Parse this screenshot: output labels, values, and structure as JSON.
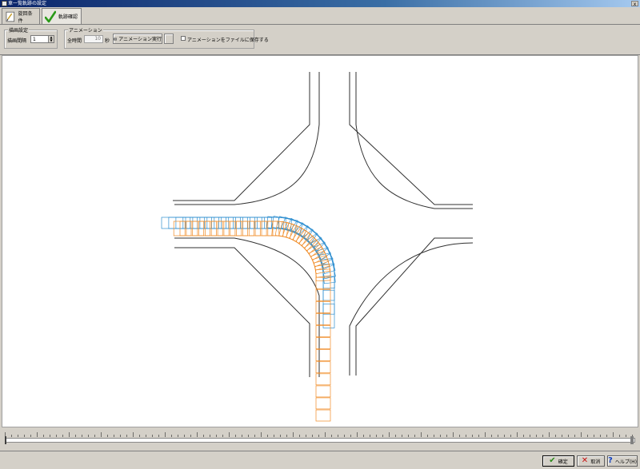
{
  "window": {
    "title": "車一覧軌跡の設定",
    "close_label": "x"
  },
  "tabs": [
    {
      "label": "旋回条件",
      "icon": "document-icon"
    },
    {
      "label": "軌跡確認",
      "icon": "checkmark-icon"
    }
  ],
  "draw_settings": {
    "group_title": "描画設定",
    "interval_label": "描画間隔",
    "interval_value": "1"
  },
  "animation": {
    "group_title": "アニメーション",
    "total_time_label": "全時間",
    "total_time_value": "10",
    "total_time_unit": "秒",
    "run_label": "アニメーション実行",
    "save_checkbox_label": "アニメーションをファイルに保存する",
    "save_checked": false
  },
  "footer": {
    "ok_label": "確定",
    "cancel_label": "取消",
    "help_label": "ヘルプ(H)"
  },
  "colors": {
    "road": "#303030",
    "trajectory_blue": "#2f8fd0",
    "trajectory_orange": "#f08a24",
    "dialog_bg": "#d4d0c8"
  },
  "slider": {
    "position_fraction": 0
  }
}
